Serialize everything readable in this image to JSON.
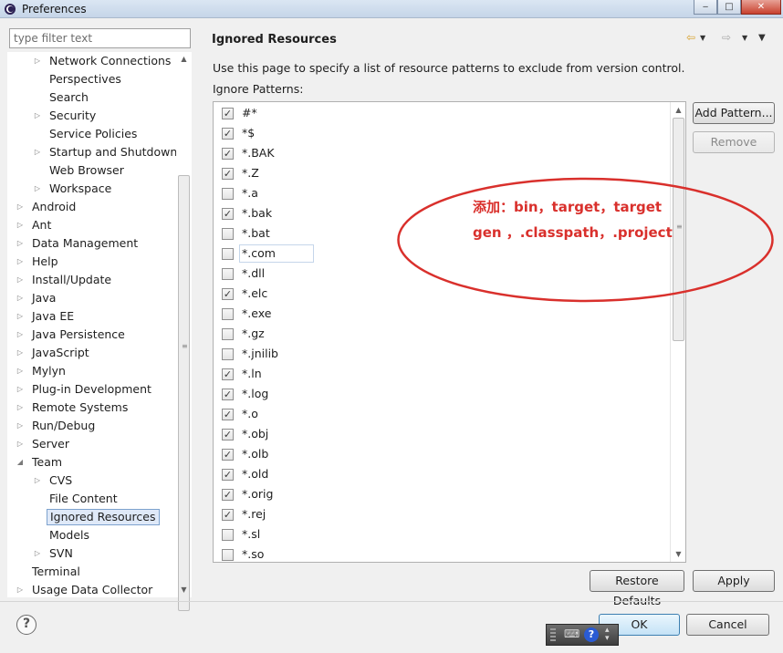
{
  "window": {
    "title": "Preferences",
    "controls": {
      "minimize": "‒",
      "maximize": "□",
      "close": "✕"
    }
  },
  "filter": {
    "placeholder": "type filter text",
    "value": ""
  },
  "tree": [
    {
      "label": "Network Connections",
      "level": 1,
      "expandable": true,
      "expanded": false,
      "selected": false
    },
    {
      "label": "Perspectives",
      "level": 1,
      "expandable": false,
      "expanded": false,
      "selected": false
    },
    {
      "label": "Search",
      "level": 1,
      "expandable": false,
      "expanded": false,
      "selected": false
    },
    {
      "label": "Security",
      "level": 1,
      "expandable": true,
      "expanded": false,
      "selected": false
    },
    {
      "label": "Service Policies",
      "level": 1,
      "expandable": false,
      "expanded": false,
      "selected": false
    },
    {
      "label": "Startup and Shutdown",
      "level": 1,
      "expandable": true,
      "expanded": false,
      "selected": false
    },
    {
      "label": "Web Browser",
      "level": 1,
      "expandable": false,
      "expanded": false,
      "selected": false
    },
    {
      "label": "Workspace",
      "level": 1,
      "expandable": true,
      "expanded": false,
      "selected": false
    },
    {
      "label": "Android",
      "level": 0,
      "expandable": true,
      "expanded": false,
      "selected": false
    },
    {
      "label": "Ant",
      "level": 0,
      "expandable": true,
      "expanded": false,
      "selected": false
    },
    {
      "label": "Data Management",
      "level": 0,
      "expandable": true,
      "expanded": false,
      "selected": false
    },
    {
      "label": "Help",
      "level": 0,
      "expandable": true,
      "expanded": false,
      "selected": false
    },
    {
      "label": "Install/Update",
      "level": 0,
      "expandable": true,
      "expanded": false,
      "selected": false
    },
    {
      "label": "Java",
      "level": 0,
      "expandable": true,
      "expanded": false,
      "selected": false
    },
    {
      "label": "Java EE",
      "level": 0,
      "expandable": true,
      "expanded": false,
      "selected": false
    },
    {
      "label": "Java Persistence",
      "level": 0,
      "expandable": true,
      "expanded": false,
      "selected": false
    },
    {
      "label": "JavaScript",
      "level": 0,
      "expandable": true,
      "expanded": false,
      "selected": false
    },
    {
      "label": "Mylyn",
      "level": 0,
      "expandable": true,
      "expanded": false,
      "selected": false
    },
    {
      "label": "Plug-in Development",
      "level": 0,
      "expandable": true,
      "expanded": false,
      "selected": false
    },
    {
      "label": "Remote Systems",
      "level": 0,
      "expandable": true,
      "expanded": false,
      "selected": false
    },
    {
      "label": "Run/Debug",
      "level": 0,
      "expandable": true,
      "expanded": false,
      "selected": false
    },
    {
      "label": "Server",
      "level": 0,
      "expandable": true,
      "expanded": false,
      "selected": false
    },
    {
      "label": "Team",
      "level": 0,
      "expandable": true,
      "expanded": true,
      "selected": false
    },
    {
      "label": "CVS",
      "level": 1,
      "expandable": true,
      "expanded": false,
      "selected": false
    },
    {
      "label": "File Content",
      "level": 1,
      "expandable": false,
      "expanded": false,
      "selected": false
    },
    {
      "label": "Ignored Resources",
      "level": 1,
      "expandable": false,
      "expanded": false,
      "selected": true
    },
    {
      "label": "Models",
      "level": 1,
      "expandable": false,
      "expanded": false,
      "selected": false
    },
    {
      "label": "SVN",
      "level": 1,
      "expandable": true,
      "expanded": false,
      "selected": false
    },
    {
      "label": "Terminal",
      "level": 0,
      "expandable": false,
      "expanded": false,
      "selected": false
    },
    {
      "label": "Usage Data Collector",
      "level": 0,
      "expandable": true,
      "expanded": false,
      "selected": false
    }
  ],
  "page": {
    "title": "Ignored Resources",
    "description": "Use this page to specify a list of resource patterns to exclude from version control.",
    "patterns_label": "Ignore Patterns:"
  },
  "patterns": [
    {
      "pattern": "#*",
      "checked": true
    },
    {
      "pattern": "*$",
      "checked": true
    },
    {
      "pattern": "*.BAK",
      "checked": true
    },
    {
      "pattern": "*.Z",
      "checked": true
    },
    {
      "pattern": "*.a",
      "checked": false
    },
    {
      "pattern": "*.bak",
      "checked": true
    },
    {
      "pattern": "*.bat",
      "checked": false
    },
    {
      "pattern": "*.com",
      "checked": false,
      "focused": true
    },
    {
      "pattern": "*.dll",
      "checked": false
    },
    {
      "pattern": "*.elc",
      "checked": true
    },
    {
      "pattern": "*.exe",
      "checked": false
    },
    {
      "pattern": "*.gz",
      "checked": false
    },
    {
      "pattern": "*.jnilib",
      "checked": false
    },
    {
      "pattern": "*.ln",
      "checked": true
    },
    {
      "pattern": "*.log",
      "checked": true
    },
    {
      "pattern": "*.o",
      "checked": true
    },
    {
      "pattern": "*.obj",
      "checked": true
    },
    {
      "pattern": "*.olb",
      "checked": true
    },
    {
      "pattern": "*.old",
      "checked": true
    },
    {
      "pattern": "*.orig",
      "checked": true
    },
    {
      "pattern": "*.rej",
      "checked": true
    },
    {
      "pattern": "*.sl",
      "checked": false
    },
    {
      "pattern": "*.so",
      "checked": false
    }
  ],
  "buttons": {
    "add_pattern": "Add Pattern...",
    "remove": "Remove",
    "restore_defaults": "Restore Defaults",
    "apply": "Apply",
    "ok": "OK",
    "cancel": "Cancel"
  },
  "annotation": {
    "line1": "添加：bin，target，target",
    "line2": "gen ，.classpath，.project",
    "color": "#d9302c"
  },
  "ime_bar": {
    "help_label": "?"
  },
  "colors": {
    "selection_bg": "#dfe9f8",
    "selection_border": "#7da2ce",
    "annotation_red": "#d9302c",
    "ok_button_border": "#3c7fb1"
  }
}
